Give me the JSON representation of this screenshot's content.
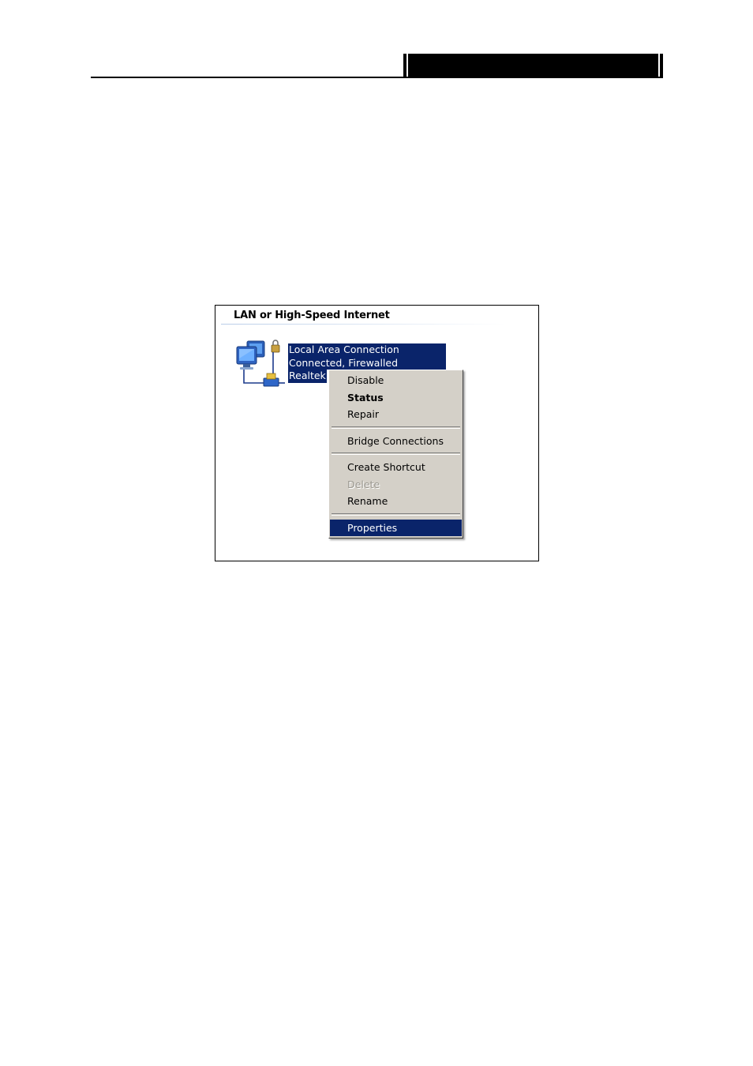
{
  "screenshot": {
    "group_title": "LAN or High-Speed Internet",
    "connection": {
      "name": "Local Area Connection",
      "status": "Connected, Firewalled",
      "device": "Realtek",
      "icon": "network-connection-icon"
    },
    "context_menu": {
      "items": [
        {
          "label": "Disable",
          "style": "normal"
        },
        {
          "label": "Status",
          "style": "bold"
        },
        {
          "label": "Repair",
          "style": "normal"
        },
        {
          "label": "Bridge Connections",
          "style": "normal"
        },
        {
          "label": "Create Shortcut",
          "style": "normal"
        },
        {
          "label": "Delete",
          "style": "disabled"
        },
        {
          "label": "Rename",
          "style": "normal"
        },
        {
          "label": "Properties",
          "style": "selected"
        }
      ]
    }
  },
  "colors": {
    "selection": "#0a246a",
    "menu_background": "#d4d0c8",
    "header_bar": "#000000"
  }
}
